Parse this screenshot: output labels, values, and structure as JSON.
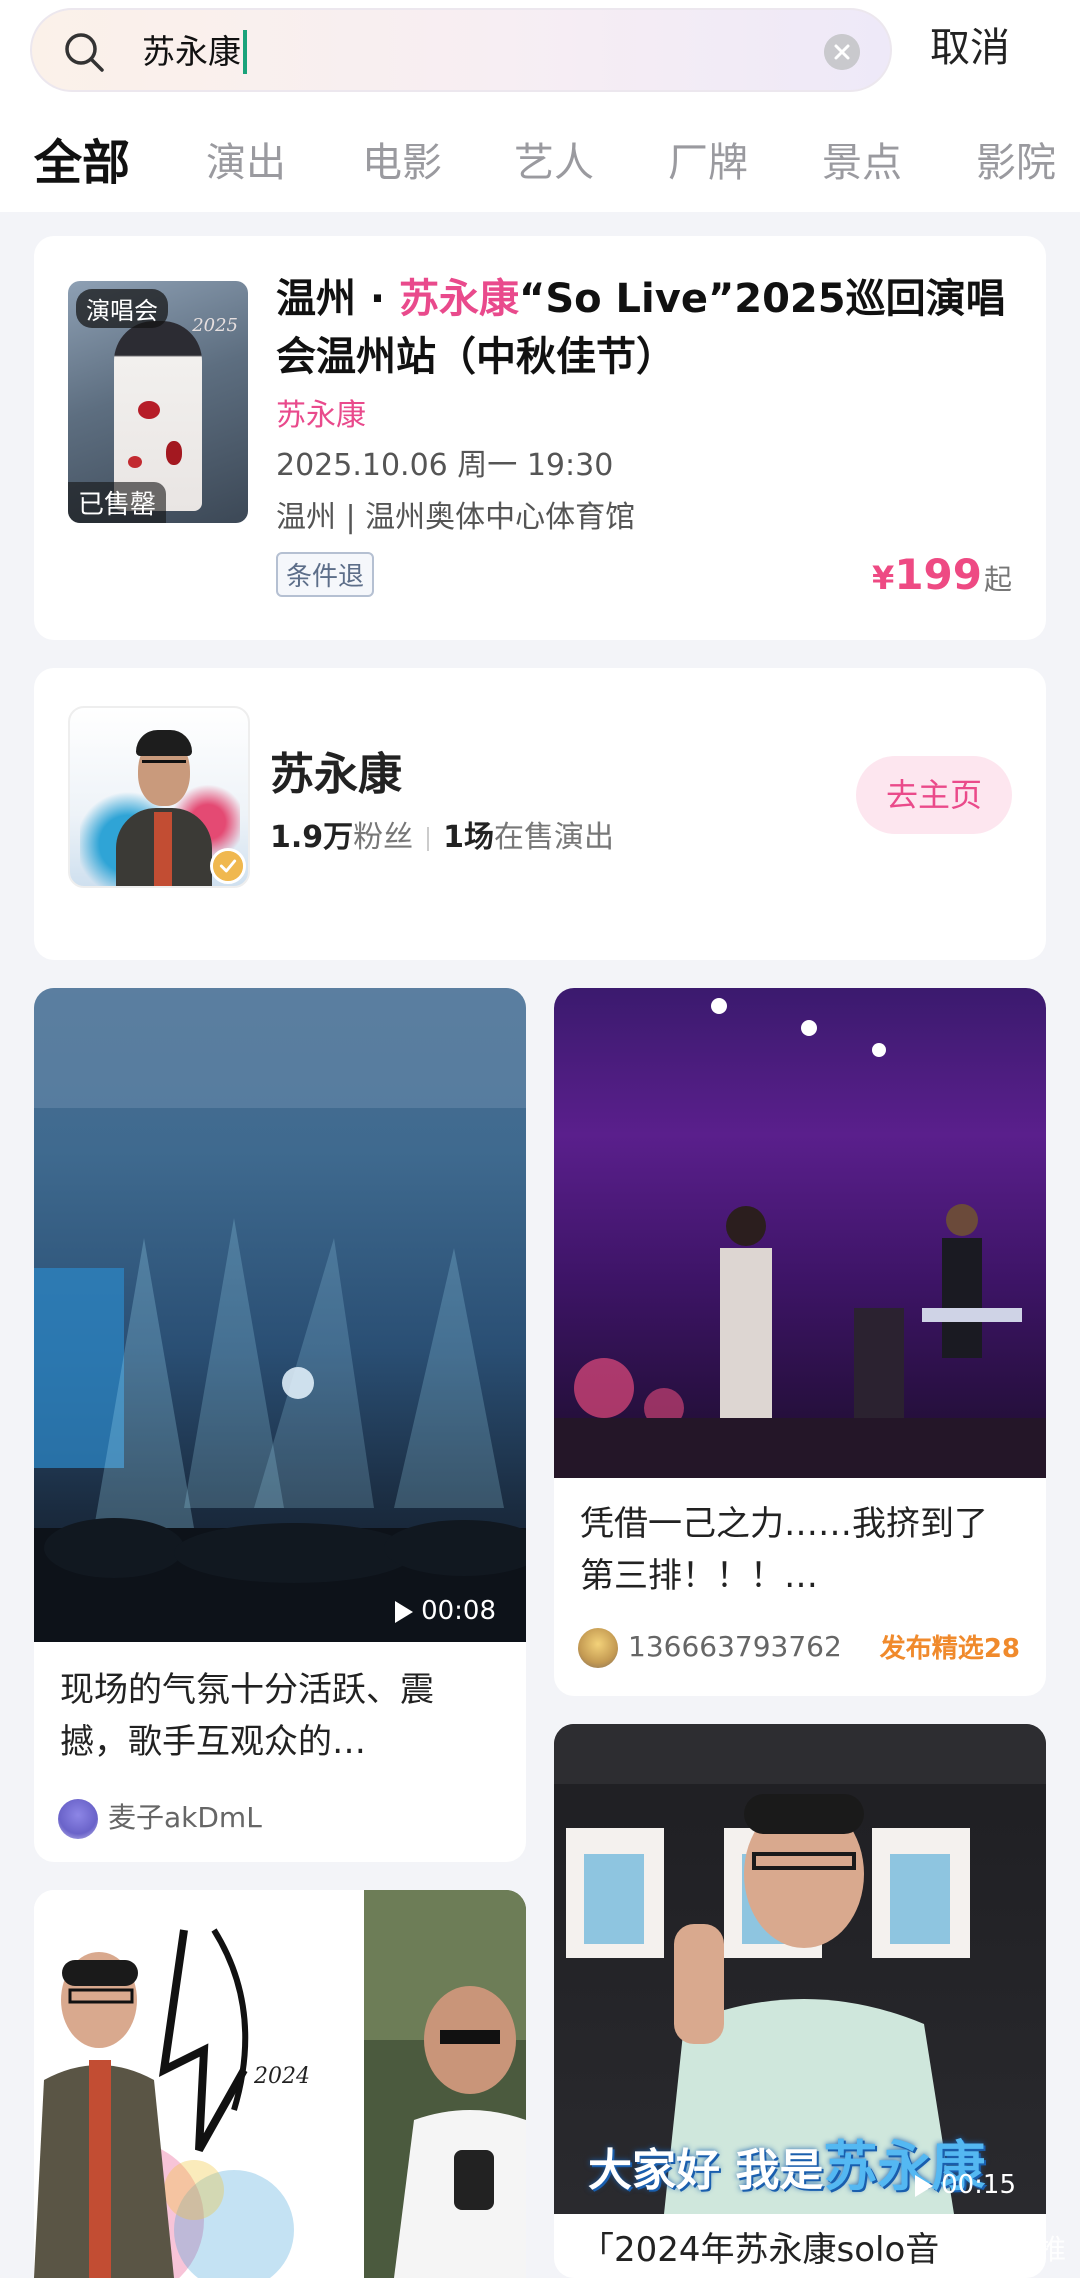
{
  "search": {
    "query": "苏永康",
    "cancel_label": "取消"
  },
  "tabs": [
    {
      "label": "全部",
      "active": true
    },
    {
      "label": "演出"
    },
    {
      "label": "电影"
    },
    {
      "label": "艺人"
    },
    {
      "label": "厂牌"
    },
    {
      "label": "景点"
    },
    {
      "label": "影院"
    }
  ],
  "event": {
    "badge_type": "演唱会",
    "badge_status": "已售罄",
    "poster_year": "2025",
    "title_prefix": "温州 · ",
    "title_highlight": "苏永康",
    "title_suffix": "“So Live”2025巡回演唱会温州站（中秋佳节）",
    "artist": "苏永康",
    "datetime": "2025.10.06 周一 19:30",
    "venue": "温州 | 温州奥体中心体育馆",
    "refund_tag": "条件退",
    "price_currency": "¥",
    "price_value": "199",
    "price_suffix": "起"
  },
  "artist_card": {
    "name": "苏永康",
    "fans_count": "1.9万",
    "fans_label": "粉丝",
    "shows_count": "1场",
    "shows_label": "在售演出",
    "homepage_label": "去主页"
  },
  "feed": {
    "post1": {
      "caption": "现场的气氛十分活跃、震撼，歌手互观众的…",
      "duration": "00:08",
      "user": "麦子akDmL"
    },
    "post2": {
      "caption": "凭借一己之力……我挤到了第三排！！！…",
      "user": "136663793762",
      "featured_label": "发布精选",
      "featured_count": "28"
    },
    "post3": {
      "overlay_text_prefix": "大家好 我是",
      "overlay_text_name": "苏永康",
      "duration": "00:15",
      "caption": "「2024年苏永康solo音"
    },
    "post4": {
      "poster_year": "2024"
    }
  },
  "watermark": "@皮皮推",
  "colors": {
    "accent_pink": "#e94a8c",
    "price_pink": "#ee4a83",
    "featured_orange": "#f08a2c",
    "caret_green": "#1aa37a"
  }
}
